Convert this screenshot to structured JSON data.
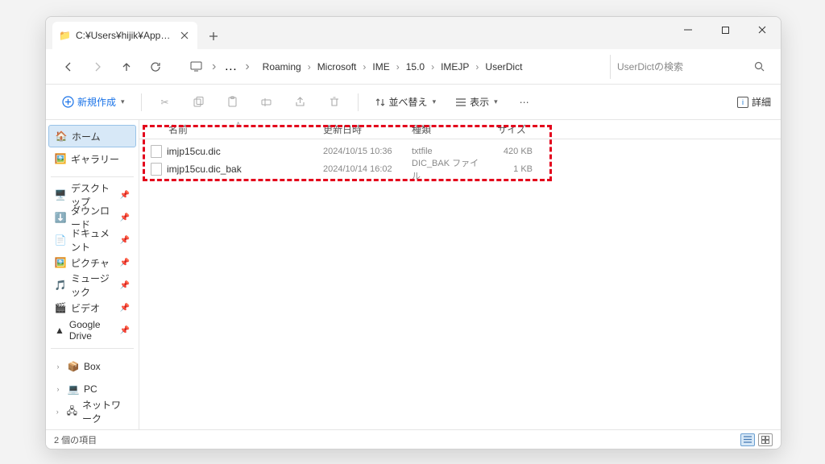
{
  "titlebar": {
    "tab_title": "C:¥Users¥hijik¥AppData¥Roan"
  },
  "breadcrumbs": [
    "Roaming",
    "Microsoft",
    "IME",
    "15.0",
    "IMEJP",
    "UserDict"
  ],
  "search": {
    "placeholder": "UserDictの検索"
  },
  "toolbar": {
    "new_label": "新規作成",
    "sort_label": "並べ替え",
    "view_label": "表示",
    "details_label": "詳細"
  },
  "sidebar": {
    "home": "ホーム",
    "gallery": "ギャラリー",
    "quick": [
      {
        "label": "デスクトップ",
        "icon": "🖥️"
      },
      {
        "label": "ダウンロード",
        "icon": "⬇️"
      },
      {
        "label": "ドキュメント",
        "icon": "📄"
      },
      {
        "label": "ピクチャ",
        "icon": "🖼️"
      },
      {
        "label": "ミュージック",
        "icon": "🎵"
      },
      {
        "label": "ビデオ",
        "icon": "🎬"
      },
      {
        "label": "Google Drive",
        "icon": "▲"
      }
    ],
    "drives": [
      {
        "label": "Box",
        "icon": "📦"
      },
      {
        "label": "PC",
        "icon": "💻"
      },
      {
        "label": "ネットワーク",
        "icon": "🖧"
      }
    ]
  },
  "columns": {
    "name": "名前",
    "date": "更新日時",
    "type": "種類",
    "size": "サイズ"
  },
  "files": [
    {
      "name": "imjp15cu.dic",
      "date": "2024/10/15 10:36",
      "type": "txtfile",
      "size": "420 KB"
    },
    {
      "name": "imjp15cu.dic_bak",
      "date": "2024/10/14 16:02",
      "type": "DIC_BAK ファイル",
      "size": "1 KB"
    }
  ],
  "status": {
    "count": "2 個の項目"
  }
}
